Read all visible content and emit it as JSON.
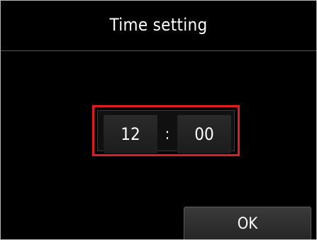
{
  "header": {
    "title": "Time setting"
  },
  "time": {
    "hours": "12",
    "separator": ":",
    "minutes": "00"
  },
  "actions": {
    "ok_label": "OK"
  },
  "colors": {
    "screen_background": "#000000",
    "selection_border": "#e01c22",
    "field_background": "#222222",
    "button_background": "#2e2e2e",
    "text": "#ffffff"
  }
}
